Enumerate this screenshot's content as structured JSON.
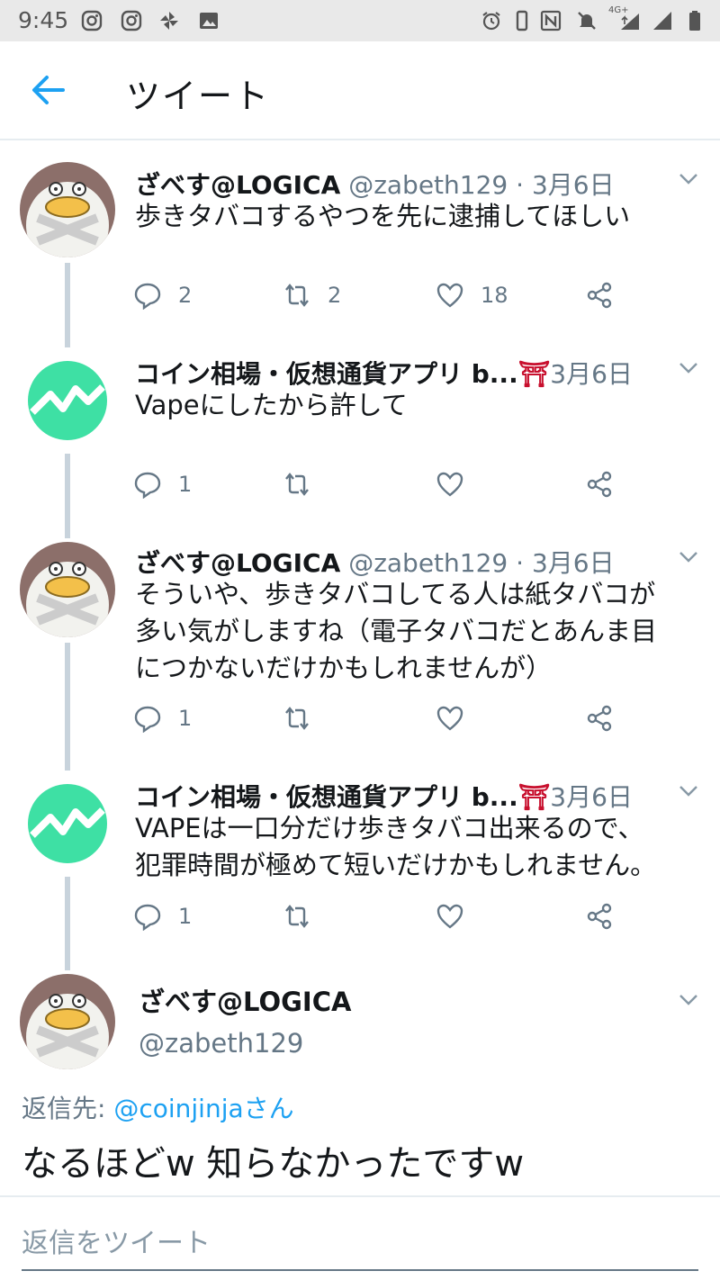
{
  "status_bar": {
    "time": "9:45",
    "left_icons": [
      "instagram-icon",
      "instagram-icon",
      "pinwheel-icon",
      "image-icon"
    ],
    "right_icons": [
      "alarm-icon",
      "vibrate-icon",
      "nfc-icon",
      "mute-icon",
      "network-4g-icon",
      "signal-icon",
      "battery-icon"
    ],
    "network_label": "4G+"
  },
  "header": {
    "back_icon": "arrow-left-icon",
    "title": "ツイート"
  },
  "colors": {
    "accent": "#1da1f2",
    "text": "#14171a",
    "muted": "#657786",
    "thread_line": "#c8d3dc",
    "coin_avatar": "#3ee0a4",
    "torii": "#c8102e"
  },
  "thread": [
    {
      "name": "ざべす@LOGICA",
      "handle": "@zabeth129",
      "separator": "·",
      "date": "3月6日",
      "text_lines": [
        "歩きタバコするやつを先に逮捕してほしい"
      ],
      "replies": "2",
      "retweets": "2",
      "likes": "18",
      "avatar": "duck-avatar"
    },
    {
      "name": "コイン相場・仮想通貨アプリ b...",
      "torii": "⛩",
      "handle": "",
      "separator": "",
      "date": "3月6日",
      "text_lines": [
        "Vapeにしたから許して"
      ],
      "replies": "1",
      "retweets": "",
      "likes": "",
      "avatar": "coin-chart-avatar"
    },
    {
      "name": "ざべす@LOGICA",
      "handle": "@zabeth129",
      "separator": "·",
      "date": "3月6日",
      "text_lines": [
        "そういや、歩きタバコしてる人は紙タバコが",
        "多い気がしますね（電子タバコだとあんま目",
        "につかないだけかもしれませんが）"
      ],
      "replies": "1",
      "retweets": "",
      "likes": "",
      "avatar": "duck-avatar"
    },
    {
      "name": "コイン相場・仮想通貨アプリ b...",
      "torii": "⛩",
      "handle": "",
      "separator": "",
      "date": "3月6日",
      "text_lines": [
        "VAPEは一口分だけ歩きタバコ出来るので、",
        "犯罪時間が極めて短いだけかもしれません。"
      ],
      "replies": "1",
      "retweets": "",
      "likes": "",
      "avatar": "coin-chart-avatar"
    }
  ],
  "focused": {
    "name": "ざべす@LOGICA",
    "handle": "@zabeth129",
    "reply_to_label": "返信先: ",
    "reply_to_user": "@coinjinja",
    "reply_to_suffix": "さん",
    "text": "なるほどw 知らなかったですw"
  },
  "compose": {
    "placeholder": "返信をツイート"
  }
}
